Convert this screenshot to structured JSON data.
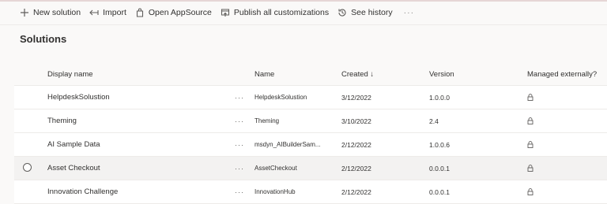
{
  "commands": [
    {
      "label": "New solution",
      "icon": "plus-icon"
    },
    {
      "label": "Import",
      "icon": "import-arrow-icon"
    },
    {
      "label": "Open AppSource",
      "icon": "shopping-bag-icon"
    },
    {
      "label": "Publish all customizations",
      "icon": "publish-icon"
    },
    {
      "label": "See history",
      "icon": "history-icon"
    }
  ],
  "more_label": "···",
  "page_title": "Solutions",
  "columns": {
    "display_name": "Display name",
    "name": "Name",
    "created": "Created ↓",
    "version": "Version",
    "managed": "Managed externally?"
  },
  "row_menu_label": "···",
  "rows": [
    {
      "display_name": "HelpdeskSolustion",
      "name": "HelpdeskSolustion",
      "created": "3/12/2022",
      "version": "1.0.0.0",
      "managed_icon": "lock-icon",
      "selected": false
    },
    {
      "display_name": "Theming",
      "name": "Theming",
      "created": "3/10/2022",
      "version": "2.4",
      "managed_icon": "lock-icon",
      "selected": false
    },
    {
      "display_name": "AI Sample Data",
      "name": "msdyn_AIBuilderSam...",
      "created": "2/12/2022",
      "version": "1.0.0.6",
      "managed_icon": "lock-icon",
      "selected": false
    },
    {
      "display_name": "Asset Checkout",
      "name": "AssetCheckout",
      "created": "2/12/2022",
      "version": "0.0.0.1",
      "managed_icon": "lock-icon",
      "selected": true
    },
    {
      "display_name": "Innovation Challenge",
      "name": "InnovationHub",
      "created": "2/12/2022",
      "version": "0.0.0.1",
      "managed_icon": "lock-icon",
      "selected": false
    }
  ],
  "colors": {
    "highlight": "#fff200",
    "accent": "#0078d4",
    "text": "#323130"
  }
}
